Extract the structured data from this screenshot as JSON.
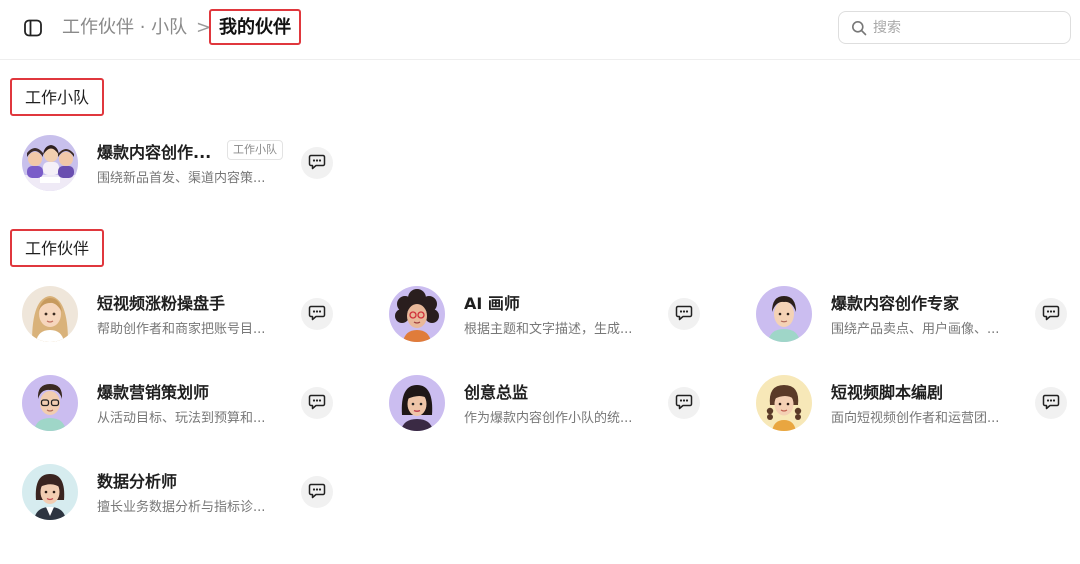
{
  "header": {
    "breadcrumb_parent": "工作伙伴 · 小队",
    "breadcrumb_separator": ">",
    "breadcrumb_current": "我的伙伴"
  },
  "search": {
    "placeholder": "搜索",
    "value": ""
  },
  "sections": {
    "team": {
      "title": "工作小队",
      "items": [
        {
          "name": "爆款内容创作...",
          "tag": "工作小队",
          "desc": "围绕新品首发、渠道内容策...",
          "avatar": "team-avatar"
        }
      ]
    },
    "partners": {
      "title": "工作伙伴",
      "items": [
        {
          "name": "短视频涨粉操盘手",
          "desc": "帮助创作者和商家把账号目...",
          "avatar": "blonde-woman-avatar"
        },
        {
          "name": "AI 画师",
          "desc": "根据主题和文字描述，生成...",
          "avatar": "curly-hair-woman-avatar"
        },
        {
          "name": "爆款内容创作专家",
          "desc": "围绕产品卖点、用户画像、...",
          "avatar": "young-man-avatar"
        },
        {
          "name": "爆款营销策划师",
          "desc": "从活动目标、玩法到预算和...",
          "avatar": "glasses-man-avatar"
        },
        {
          "name": "创意总监",
          "desc": "作为爆款内容创作小队的统...",
          "avatar": "bob-hair-woman-avatar"
        },
        {
          "name": "短视频脚本编剧",
          "desc": "面向短视频创作者和运营团...",
          "avatar": "braided-girl-avatar"
        },
        {
          "name": "数据分析师",
          "desc": "擅长业务数据分析与指标诊...",
          "avatar": "suit-woman-avatar"
        }
      ]
    }
  },
  "colors": {
    "highlight_border": "#e0373d",
    "chat_button_bg": "#f1f1f1",
    "muted_text": "#777777"
  },
  "icons": {
    "sidebar_toggle": "sidebar-toggle-icon",
    "search": "search-icon",
    "chat": "chat-bubble-icon"
  }
}
